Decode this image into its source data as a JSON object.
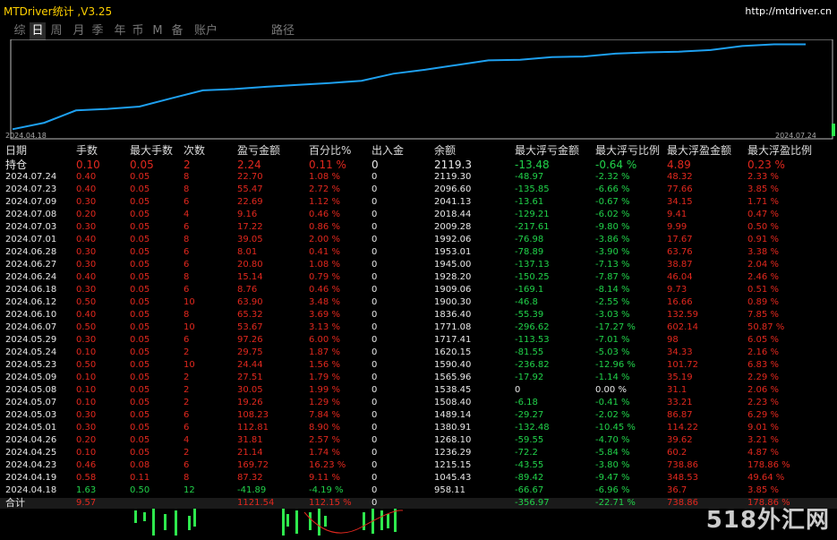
{
  "window": {
    "title": "MTDriver统计 ,V3.25",
    "url": "http://mtdriver.cn"
  },
  "tabs": [
    "综",
    "日",
    "周",
    "月",
    "季",
    "年",
    "币",
    "M",
    "备",
    "账户",
    "路径"
  ],
  "active_tab": "日",
  "chart_data": {
    "type": "line",
    "x": [
      "2024.04.18",
      "2024.04.19",
      "2024.04.23",
      "2024.04.25",
      "2024.04.26",
      "2024.05.01",
      "2024.05.03",
      "2024.05.07",
      "2024.05.08",
      "2024.05.09",
      "2024.05.23",
      "2024.05.24",
      "2024.05.29",
      "2024.06.07",
      "2024.06.10",
      "2024.06.12",
      "2024.06.18",
      "2024.06.24",
      "2024.06.27",
      "2024.06.28",
      "2024.07.01",
      "2024.07.03",
      "2024.07.08",
      "2024.07.09",
      "2024.07.23",
      "2024.07.24"
    ],
    "y": [
      958.11,
      1045.43,
      1215.15,
      1236.29,
      1268.1,
      1380.91,
      1489.14,
      1508.4,
      1538.45,
      1565.96,
      1590.4,
      1620.15,
      1717.41,
      1771.08,
      1836.4,
      1900.3,
      1909.06,
      1945.0,
      1953.01,
      1992.06,
      2009.28,
      2018.44,
      2041.13,
      2096.6,
      2119.3,
      2119.3
    ],
    "x_start_label": "2024.04.18",
    "x_end_label": "2024.07.24",
    "color": "#1ea0f0"
  },
  "table": {
    "headers": [
      "日期",
      "手数",
      "最大手数",
      "次数",
      "盈亏金额",
      "百分比%",
      "出入金",
      "余额",
      "最大浮亏金额",
      "最大浮亏比例",
      "最大浮盈金额",
      "最大浮盈比例"
    ],
    "rows": [
      [
        "持仓",
        "0.10",
        "0.05",
        "2",
        "2.24",
        "0.11 %",
        "0",
        "2119.3",
        "-13.48",
        "-0.64 %",
        "4.89",
        "0.23 %"
      ],
      [
        "2024.07.24",
        "0.40",
        "0.05",
        "8",
        "22.70",
        "1.08 %",
        "0",
        "2119.30",
        "-48.97",
        "-2.32 %",
        "48.32",
        "2.33 %"
      ],
      [
        "2024.07.23",
        "0.40",
        "0.05",
        "8",
        "55.47",
        "2.72 %",
        "0",
        "2096.60",
        "-135.85",
        "-6.66 %",
        "77.66",
        "3.85 %"
      ],
      [
        "2024.07.09",
        "0.30",
        "0.05",
        "6",
        "22.69",
        "1.12 %",
        "0",
        "2041.13",
        "-13.61",
        "-0.67 %",
        "34.15",
        "1.71 %"
      ],
      [
        "2024.07.08",
        "0.20",
        "0.05",
        "4",
        "9.16",
        "0.46 %",
        "0",
        "2018.44",
        "-129.21",
        "-6.02 %",
        "9.41",
        "0.47 %"
      ],
      [
        "2024.07.03",
        "0.30",
        "0.05",
        "6",
        "17.22",
        "0.86 %",
        "0",
        "2009.28",
        "-217.61",
        "-9.80 %",
        "9.99",
        "0.50 %"
      ],
      [
        "2024.07.01",
        "0.40",
        "0.05",
        "8",
        "39.05",
        "2.00 %",
        "0",
        "1992.06",
        "-76.98",
        "-3.86 %",
        "17.67",
        "0.91 %"
      ],
      [
        "2024.06.28",
        "0.30",
        "0.05",
        "6",
        "8.01",
        "0.41 %",
        "0",
        "1953.01",
        "-78.89",
        "-3.90 %",
        "63.76",
        "3.38 %"
      ],
      [
        "2024.06.27",
        "0.30",
        "0.05",
        "6",
        "20.80",
        "1.08 %",
        "0",
        "1945.00",
        "-137.13",
        "-7.13 %",
        "38.87",
        "2.04 %"
      ],
      [
        "2024.06.24",
        "0.40",
        "0.05",
        "8",
        "15.14",
        "0.79 %",
        "0",
        "1928.20",
        "-150.25",
        "-7.87 %",
        "46.04",
        "2.46 %"
      ],
      [
        "2024.06.18",
        "0.30",
        "0.05",
        "6",
        "8.76",
        "0.46 %",
        "0",
        "1909.06",
        "-169.1",
        "-8.14 %",
        "9.73",
        "0.51 %"
      ],
      [
        "2024.06.12",
        "0.50",
        "0.05",
        "10",
        "63.90",
        "3.48 %",
        "0",
        "1900.30",
        "-46.8",
        "-2.55 %",
        "16.66",
        "0.89 %"
      ],
      [
        "2024.06.10",
        "0.40",
        "0.05",
        "8",
        "65.32",
        "3.69 %",
        "0",
        "1836.40",
        "-55.39",
        "-3.03 %",
        "132.59",
        "7.85 %"
      ],
      [
        "2024.06.07",
        "0.50",
        "0.05",
        "10",
        "53.67",
        "3.13 %",
        "0",
        "1771.08",
        "-296.62",
        "-17.27 %",
        "602.14",
        "50.87 %"
      ],
      [
        "2024.05.29",
        "0.30",
        "0.05",
        "6",
        "97.26",
        "6.00 %",
        "0",
        "1717.41",
        "-113.53",
        "-7.01 %",
        "98",
        "6.05 %"
      ],
      [
        "2024.05.24",
        "0.10",
        "0.05",
        "2",
        "29.75",
        "1.87 %",
        "0",
        "1620.15",
        "-81.55",
        "-5.03 %",
        "34.33",
        "2.16 %"
      ],
      [
        "2024.05.23",
        "0.50",
        "0.05",
        "10",
        "24.44",
        "1.56 %",
        "0",
        "1590.40",
        "-236.82",
        "-12.96 %",
        "101.72",
        "6.83 %"
      ],
      [
        "2024.05.09",
        "0.10",
        "0.05",
        "2",
        "27.51",
        "1.79 %",
        "0",
        "1565.96",
        "-17.92",
        "-1.14 %",
        "35.19",
        "2.29 %"
      ],
      [
        "2024.05.08",
        "0.10",
        "0.05",
        "2",
        "30.05",
        "1.99 %",
        "0",
        "1538.45",
        "0",
        "0.00 %",
        "31.1",
        "2.06 %"
      ],
      [
        "2024.05.07",
        "0.10",
        "0.05",
        "2",
        "19.26",
        "1.29 %",
        "0",
        "1508.40",
        "-6.18",
        "-0.41 %",
        "33.21",
        "2.23 %"
      ],
      [
        "2024.05.03",
        "0.30",
        "0.05",
        "6",
        "108.23",
        "7.84 %",
        "0",
        "1489.14",
        "-29.27",
        "-2.02 %",
        "86.87",
        "6.29 %"
      ],
      [
        "2024.05.01",
        "0.30",
        "0.05",
        "6",
        "112.81",
        "8.90 %",
        "0",
        "1380.91",
        "-132.48",
        "-10.45 %",
        "114.22",
        "9.01 %"
      ],
      [
        "2024.04.26",
        "0.20",
        "0.05",
        "4",
        "31.81",
        "2.57 %",
        "0",
        "1268.10",
        "-59.55",
        "-4.70 %",
        "39.62",
        "3.21 %"
      ],
      [
        "2024.04.25",
        "0.10",
        "0.05",
        "2",
        "21.14",
        "1.74 %",
        "0",
        "1236.29",
        "-72.2",
        "-5.84 %",
        "60.2",
        "4.87 %"
      ],
      [
        "2024.04.23",
        "0.46",
        "0.08",
        "6",
        "169.72",
        "16.23 %",
        "0",
        "1215.15",
        "-43.55",
        "-3.80 %",
        "738.86",
        "178.86 %"
      ],
      [
        "2024.04.19",
        "0.58",
        "0.11",
        "8",
        "87.32",
        "9.11 %",
        "0",
        "1045.43",
        "-89.42",
        "-9.47 %",
        "348.53",
        "49.64 %"
      ],
      [
        "2024.04.18",
        "1.63",
        "0.50",
        "12",
        "-41.89",
        "-4.19 %",
        "0",
        "958.11",
        "-66.67",
        "-6.96 %",
        "36.7",
        "3.85 %"
      ]
    ],
    "totals": [
      "合计",
      "9.57",
      "",
      "",
      "1121.54",
      "112.15 %",
      "0",
      "",
      "-356.97",
      "-22.71 %",
      "738.86",
      "178.86 %"
    ]
  },
  "watermark": "518外汇网"
}
